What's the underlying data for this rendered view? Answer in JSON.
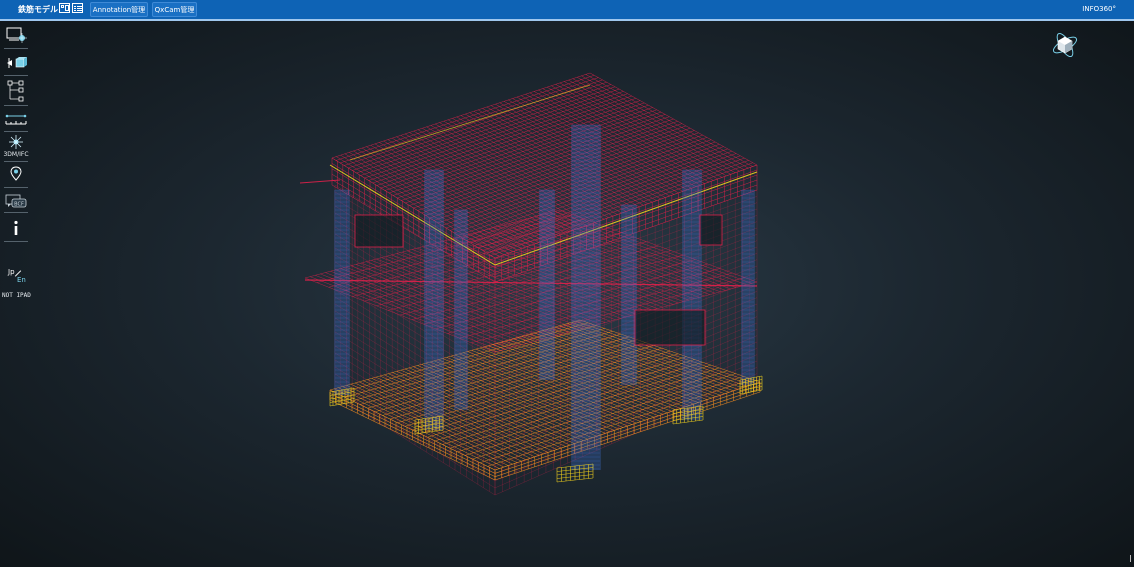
{
  "header": {
    "app_title": "鉄筋モデル",
    "buttons": {
      "annotation": "Annotation管理",
      "qxcam": "QxCam管理"
    },
    "brand": "INFO360°"
  },
  "toolbar": {
    "items": [
      {
        "icon": "screen-capture-icon"
      },
      {
        "icon": "section-box-icon"
      },
      {
        "icon": "model-tree-icon"
      },
      {
        "icon": "measure-icon"
      },
      {
        "icon": "explode-icon",
        "label": "3DM/IFC"
      },
      {
        "icon": "map-pin-icon"
      },
      {
        "icon": "bcf-comment-icon",
        "label": "BCF"
      },
      {
        "icon": "info-icon"
      },
      {
        "icon": "language-toggle-icon",
        "jp": "Jp",
        "en": "En"
      }
    ],
    "device_note": "NOT IPAD"
  },
  "viewer": {
    "model": "3D rebar wireframe building model",
    "navigation_icon": "view-cube-icon"
  },
  "colors": {
    "topbar": "#0e63b5",
    "background_center": "#2a3a46",
    "background_edge": "#0f1519",
    "rebar_red": "#e0204a",
    "rebar_orange": "#f08a20",
    "rebar_yellow": "#f2d21e",
    "column_blue": "#3f73d8",
    "accent_cyan": "#7ad0e8"
  }
}
